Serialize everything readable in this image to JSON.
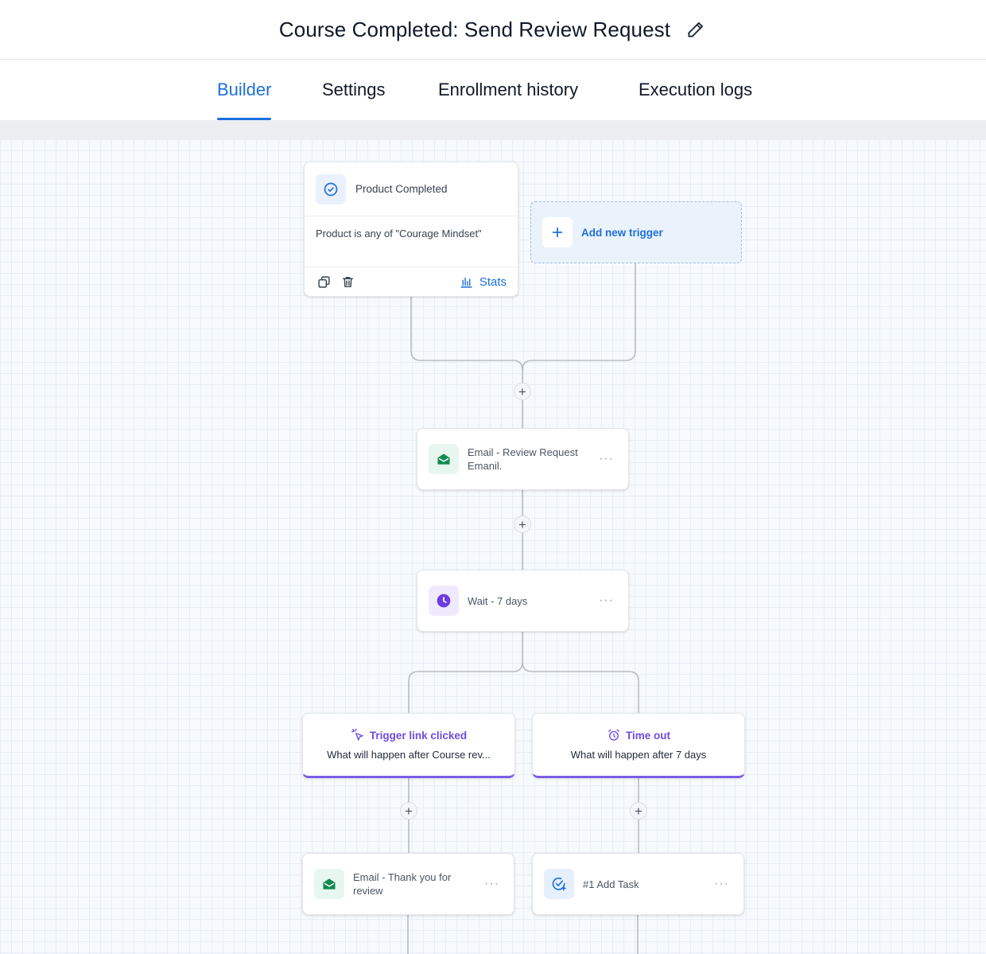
{
  "header": {
    "title": "Course Completed: Send Review Request"
  },
  "tabs": [
    {
      "label": "Builder",
      "active": true
    },
    {
      "label": "Settings",
      "active": false
    },
    {
      "label": "Enrollment history",
      "active": false
    },
    {
      "label": "Execution logs",
      "active": false
    }
  ],
  "trigger": {
    "name": "Product Completed",
    "condition": "Product is any of \"Courage Mindset\"",
    "stats_label": "Stats"
  },
  "add_trigger": {
    "label": "Add new trigger"
  },
  "actions": [
    {
      "label": "Email - Review Request Emanil.",
      "icon": "email-icon"
    },
    {
      "label": "Wait - 7 days",
      "icon": "clock-icon"
    },
    {
      "label": "Email - Thank you for review",
      "icon": "email-icon"
    },
    {
      "label": "#1 Add Task",
      "icon": "task-check-icon"
    }
  ],
  "branches": [
    {
      "title": "Trigger link clicked",
      "subtitle": "What will happen after Course rev...",
      "icon": "cursor-click-icon"
    },
    {
      "title": "Time out",
      "subtitle": "What will happen after 7 days",
      "icon": "alarm-clock-icon"
    }
  ],
  "more_label": "···",
  "plus_label": "+",
  "colors": {
    "accent": "#1d6fdc",
    "branch": "#6d4de0",
    "email": "#0f8a4f",
    "wait": "#6d3be0"
  }
}
